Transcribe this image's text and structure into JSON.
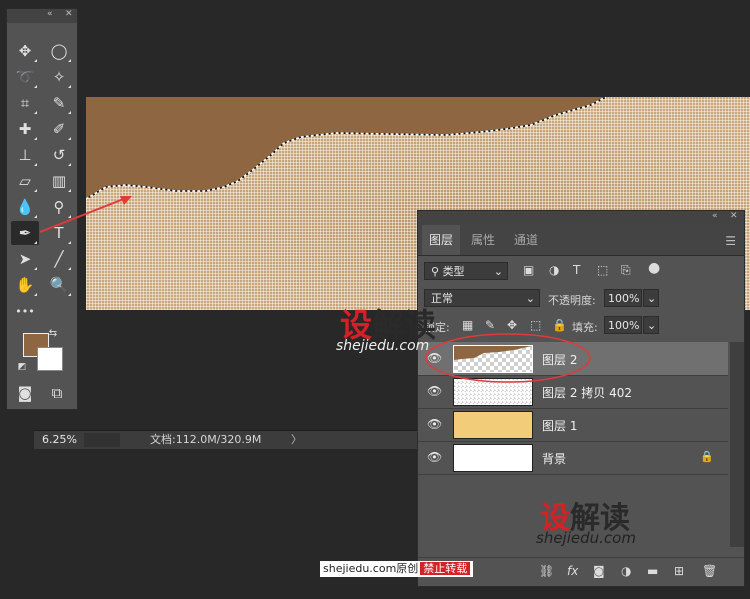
{
  "status_bar": {
    "zoom": "6.25%",
    "doc_info": "文档:112.0M/320.9M",
    "arrow": "〉"
  },
  "toolbar": {
    "collapse": "«",
    "close": "✕",
    "tools": [
      {
        "name": "move-tool",
        "glyph": "✥"
      },
      {
        "name": "elliptical-marquee-tool",
        "glyph": "◯"
      },
      {
        "name": "lasso-tool",
        "glyph": "➰"
      },
      {
        "name": "magic-wand-tool",
        "glyph": "✧"
      },
      {
        "name": "crop-tool",
        "glyph": "⌗"
      },
      {
        "name": "eyedropper-tool",
        "glyph": "✎"
      },
      {
        "name": "healing-brush-tool",
        "glyph": "✚"
      },
      {
        "name": "brush-tool",
        "glyph": "✐"
      },
      {
        "name": "clone-stamp-tool",
        "glyph": "⊥"
      },
      {
        "name": "history-brush-tool",
        "glyph": "↺"
      },
      {
        "name": "eraser-tool",
        "glyph": "▱"
      },
      {
        "name": "gradient-tool",
        "glyph": "▥"
      },
      {
        "name": "blur-tool",
        "glyph": "💧"
      },
      {
        "name": "dodge-tool",
        "glyph": "⚲"
      },
      {
        "name": "pen-tool",
        "glyph": "✒"
      },
      {
        "name": "type-tool",
        "glyph": "T"
      },
      {
        "name": "path-selection-tool",
        "glyph": "➤"
      },
      {
        "name": "line-tool",
        "glyph": "╱"
      },
      {
        "name": "hand-tool",
        "glyph": "✋"
      },
      {
        "name": "zoom-tool",
        "glyph": "🔍"
      },
      {
        "name": "more-tools",
        "glyph": "•••"
      }
    ],
    "foreground_color": "#8e6642",
    "background_color": "#ffffff"
  },
  "layers_panel": {
    "collapse": "«",
    "close": "✕",
    "tabs": [
      "图层",
      "属性",
      "通道"
    ],
    "active_tab": "图层",
    "filter_kind": "类型",
    "blend_mode": "正常",
    "opacity_label": "不透明度:",
    "opacity_value": "100%",
    "lock_label": "锁定:",
    "fill_label": "填充:",
    "fill_value": "100%",
    "layers": [
      {
        "name": "图层 2",
        "visible": true,
        "selected": true,
        "locked": false,
        "thumb": "brown-top"
      },
      {
        "name": "图层 2 拷贝 402",
        "visible": true,
        "selected": false,
        "locked": false,
        "thumb": "dots"
      },
      {
        "name": "图层 1",
        "visible": true,
        "selected": false,
        "locked": false,
        "thumb": "yellow"
      },
      {
        "name": "背景",
        "visible": true,
        "selected": false,
        "locked": true,
        "thumb": "white"
      }
    ]
  },
  "watermarks": {
    "logo_red": "设",
    "logo_dark": "解读",
    "url": "shejiedu.com",
    "credit_site": "shejiedu.com原创",
    "credit_forbid": "禁止转载"
  },
  "colors": {
    "brown": "#8e6642",
    "annotation_red": "#e03a3a",
    "panel_bg": "#535353"
  }
}
